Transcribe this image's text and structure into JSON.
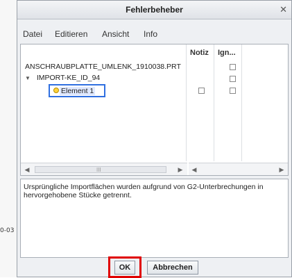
{
  "dialog": {
    "title": "Fehlerbeheber"
  },
  "menu": {
    "file": "Datei",
    "edit": "Editieren",
    "view": "Ansicht",
    "info": "Info"
  },
  "tree": {
    "columns": {
      "note": "Notiz",
      "ignore": "Ign..."
    },
    "rows": [
      {
        "label": "ANSCHRAUBPLATTE_UMLENK_1910038.PRT"
      },
      {
        "label": "IMPORT-KE_ID_94"
      },
      {
        "label": "Element 1"
      }
    ],
    "scroll_grip": "III"
  },
  "message": {
    "text": "Ursprüngliche Importflächen wurden aufgrund von G2-Unterbrechungen in hervorgehobene Stücke getrennt."
  },
  "buttons": {
    "ok": "OK",
    "cancel": "Abbrechen"
  },
  "side_text": "0-03",
  "colors": {
    "highlight_red": "#e00000",
    "selection_blue": "#2f6fe0"
  }
}
